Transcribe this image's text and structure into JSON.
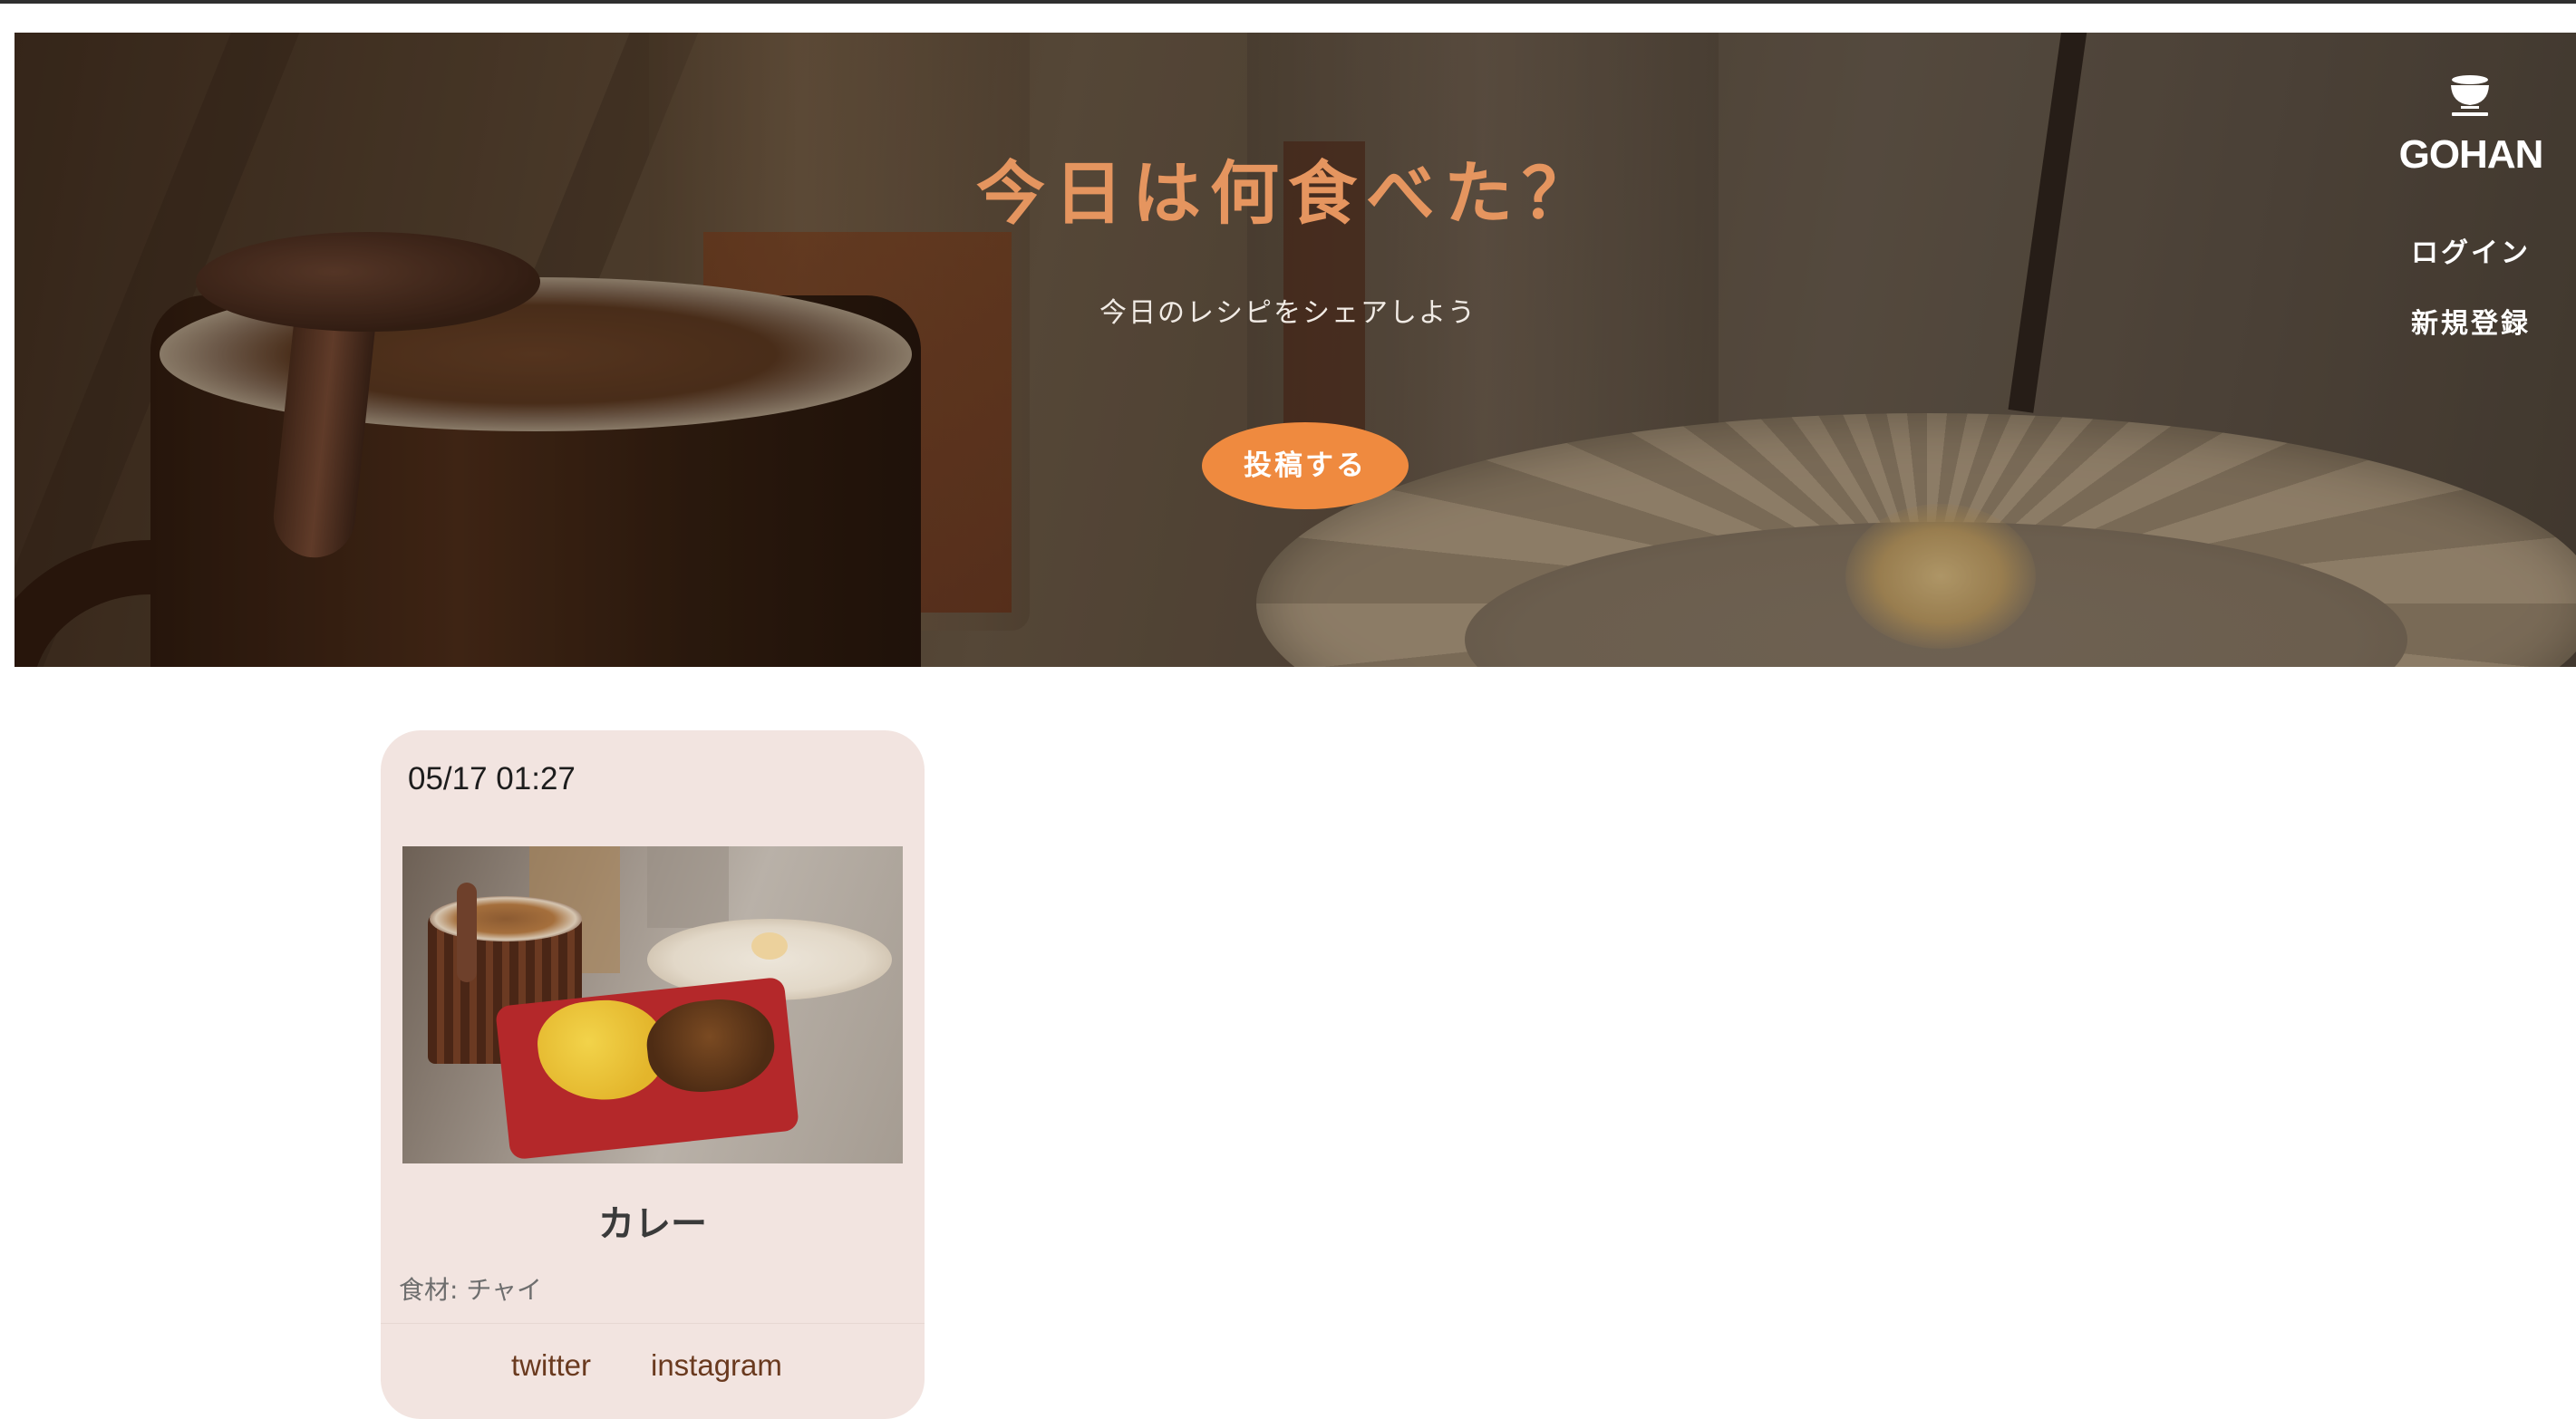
{
  "hero": {
    "title": "今日は何食べた？",
    "subtitle": "今日のレシピをシェアしよう",
    "post_button_label": "投稿する"
  },
  "nav": {
    "logo_icon": "rice-bowl-icon",
    "brand": "GOHAN",
    "login_label": "ログイン",
    "signup_label": "新規登録"
  },
  "posts": [
    {
      "date": "05/17 01:27",
      "title": "カレー",
      "ingredients": "食材: チャイ",
      "links": [
        "twitter",
        "instagram"
      ]
    }
  ],
  "colors": {
    "accent": "#ef8a3f",
    "title": "#e5955f",
    "card_bg": "#f2e4e0"
  }
}
